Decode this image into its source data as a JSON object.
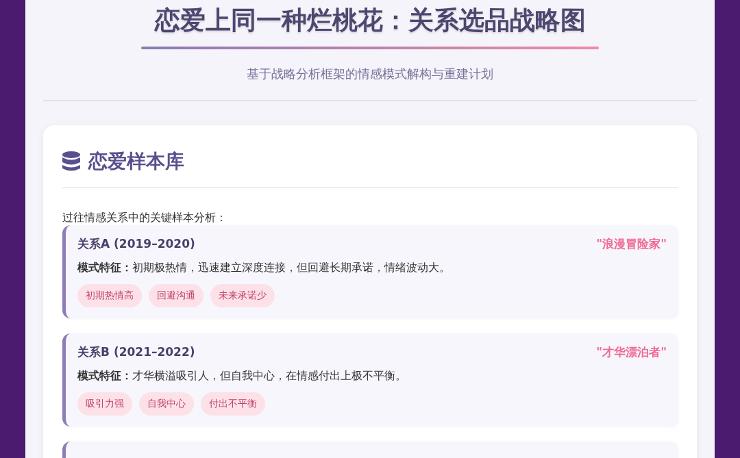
{
  "header": {
    "title": "恋爱上同一种烂桃花：关系选品战略图",
    "subtitle": "基于战略分析框架的情感模式解构与重建计划"
  },
  "section": {
    "heading": "恋爱样本库",
    "intro": "过往情感关系中的关键样本分析：",
    "samples": [
      {
        "name": "关系A (2019–2020)",
        "nickname": "\"浪漫冒险家\"",
        "description": "**模式特征：**初期极热情，迅速建立深度连接，但回避长期承诺，情绪波动大。",
        "tags": [
          "初期热情高",
          "回避沟通",
          "未来承诺少"
        ]
      },
      {
        "name": "关系B (2021–2022)",
        "nickname": "\"才华漂泊者\"",
        "description": "**模式特征：**才华横溢吸引人，但自我中心，在情感付出上极不平衡。",
        "tags": [
          "吸引力强",
          "自我中心",
          "付出不平衡"
        ]
      },
      {
        "kind": "cut"
      }
    ]
  }
}
